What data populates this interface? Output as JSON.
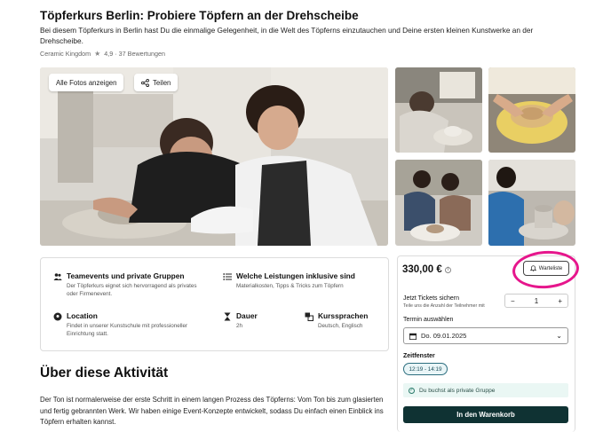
{
  "header": {
    "title": "Töpferkurs Berlin: Probiere Töpfern an der Drehscheibe",
    "subtitle": "Bei diesem Töpferkurs in Berlin hast Du die einmalige Gelegenheit, in die Welt des Töpferns einzutauchen und Deine ersten kleinen Kunstwerke an der Drehscheibe.",
    "provider": "Ceramic Kingdom",
    "rating": "4,9 · 37 Bewertungen"
  },
  "gallery": {
    "all_photos_label": "Alle Fotos anzeigen",
    "share_label": "Teilen"
  },
  "features": [
    {
      "title": "Teamevents und private Gruppen",
      "desc": "Der Töpferkurs eignet sich hervorragend als privates oder Firmenevent."
    },
    {
      "title": "Welche Leistungen inklusive sind",
      "desc": "Materialkosten, Tipps & Tricks zum Töpfern"
    },
    {
      "title": "Location",
      "desc": "Findet in unserer Kunstschule mit professioneller Einrichtung statt."
    },
    {
      "title": "Dauer",
      "desc": "2h"
    },
    {
      "title": "Kurssprachen",
      "desc": "Deutsch, Englisch"
    }
  ],
  "about": {
    "heading": "Über diese Aktivität",
    "text": "Der Ton ist normalerweise der erste Schritt in einem langen Prozess des Töpferns: Vom Ton bis zum glasierten und fertig gebrannten Werk. Wir haben einige Event-Konzepte entwickelt, sodass Du einfach einen Einblick ins Töpfern erhalten kannst."
  },
  "booking": {
    "price": "330,00 €",
    "info_symbol": "i",
    "waitlist_label": "Warteliste",
    "tickets_title": "Jetzt Tickets sichern",
    "tickets_sub": "Teile uns die Anzahl der Teilnehmer mit",
    "minus": "−",
    "quantity": "1",
    "plus": "+",
    "date_label": "Termin auswählen",
    "date_value": "Do. 09.01.2025",
    "slot_label": "Zeitfenster",
    "slot_value": "12:19 - 14:19",
    "private_note": "Du buchst als private Gruppe",
    "cart_label": "In den Warenkorb"
  },
  "colors": {
    "accent_dark": "#0f3233",
    "highlight_circle": "#e6168c",
    "slot_chip_bg": "#e9f5f7",
    "private_bg": "#eaf7f4"
  }
}
